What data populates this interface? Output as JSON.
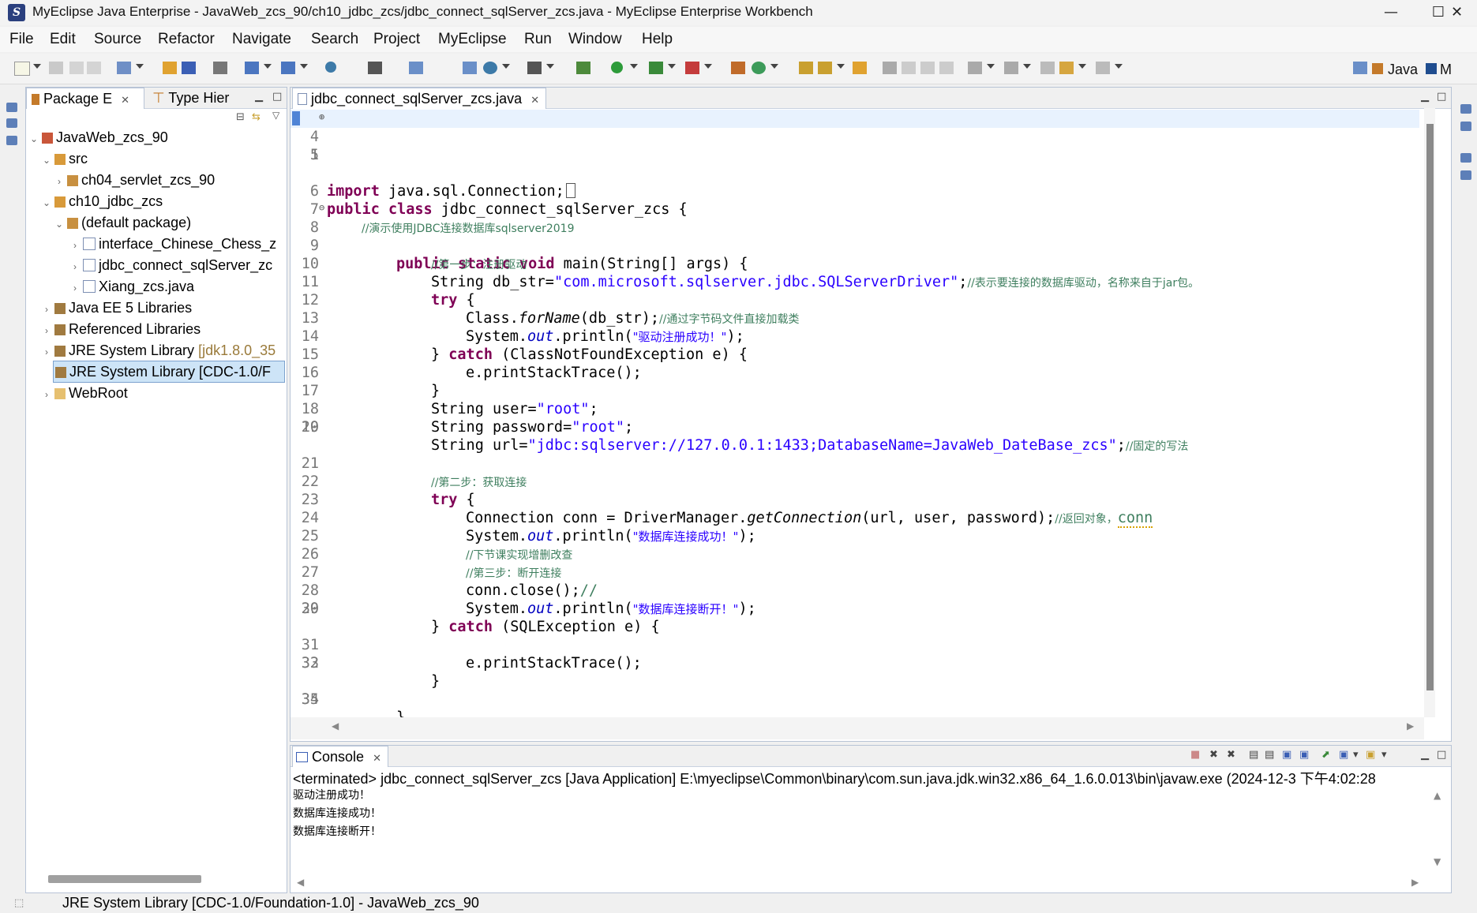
{
  "window": {
    "title": "MyEclipse Java Enterprise - JavaWeb_zcs_90/ch10_jdbc_zcs/jdbc_connect_sqlServer_zcs.java - MyEclipse Enterprise Workbench",
    "minimize": "—",
    "maximize": "☐",
    "close": "✕"
  },
  "menu": [
    "File",
    "Edit",
    "Source",
    "Refactor",
    "Navigate",
    "Search",
    "Project",
    "MyEclipse",
    "Run",
    "Window",
    "Help"
  ],
  "perspectives": {
    "java": "Java",
    "myeclipse": "M"
  },
  "package_explorer": {
    "tab_label": "Package E",
    "tab2_label": "Type Hier",
    "tree": [
      {
        "label": "JavaWeb_zcs_90",
        "icon": "project-icon"
      },
      {
        "label": "src",
        "icon": "source-folder-icon"
      },
      {
        "label": "ch04_servlet_zcs_90",
        "icon": "package-icon"
      },
      {
        "label": "ch10_jdbc_zcs",
        "icon": "source-folder-icon"
      },
      {
        "label": "(default package)",
        "icon": "package-icon"
      },
      {
        "label": "interface_Chinese_Chess_z",
        "icon": "java-file-icon"
      },
      {
        "label": "jdbc_connect_sqlServer_zc",
        "icon": "java-file-icon"
      },
      {
        "label": "Xiang_zcs.java",
        "icon": "java-file-icon"
      },
      {
        "label": "Java EE 5 Libraries",
        "icon": "library-icon"
      },
      {
        "label": "Referenced Libraries",
        "icon": "library-icon"
      },
      {
        "label": "JRE System Library",
        "suffix": "[jdk1.8.0_35",
        "icon": "library-icon"
      },
      {
        "label": "JRE System Library [CDC-1.0/F",
        "icon": "library-icon"
      },
      {
        "label": "WebRoot",
        "icon": "folder-icon"
      }
    ]
  },
  "editor": {
    "tab_label": "jdbc_connect_sqlServer_zcs.java",
    "line_numbers": [
      "1",
      "4",
      "5",
      "6",
      "7",
      "8",
      "9",
      "10",
      "11",
      "12",
      "13",
      "14",
      "15",
      "16",
      "17",
      "18",
      "19",
      "20",
      "21",
      "22",
      "23",
      "24",
      "25",
      "26",
      "27",
      "28",
      "29",
      "30",
      "31",
      "32",
      "33",
      "34",
      "35"
    ],
    "code": {
      "l1_kw": "import",
      "l1_rest": " java.sql.Connection;",
      "l6_kw1": "public",
      "l6_kw2": "class",
      "l6_rest": " jdbc_connect_sqlServer_zcs {",
      "l7_cm": "//演示使用JDBC连接数据库sqlserver2019",
      "l8_kw": "public static void",
      "l8_rest": " main(String[] args) {",
      "l9_cm": "//第一步：注册驱动",
      "l10_a": "String db_str=",
      "l10_str": "\"com.microsoft.sqlserver.jdbc.SQLServerDriver\"",
      "l10_b": ";",
      "l10_cm": "//表示要连接的数据库驱动，名称来自于jar包。",
      "l11_kw": "try",
      "l11_rest": " {",
      "l12_a": "Class.",
      "l12_it": "forName",
      "l12_b": "(db_str);",
      "l12_cm": "//通过字节码文件直接加载类",
      "l13_a": "System.",
      "l13_fld": "out",
      "l13_b": ".println(",
      "l13_str": "\"驱动注册成功！\"",
      "l13_c": ");",
      "l14_a": "} ",
      "l14_kw": "catch",
      "l14_b": " (ClassNotFoundException e) {",
      "l15": "e.printStackTrace();",
      "l16": "}",
      "l17_a": "String user=",
      "l17_str": "\"root\"",
      "l17_b": ";",
      "l18_a": "String password=",
      "l18_str": "\"root\"",
      "l18_b": ";",
      "l19_a": "String url=",
      "l19_str": "\"jdbc:sqlserver://127.0.0.1:1433;DatabaseName=JavaWeb_DateBase_zcs\"",
      "l19_b": ";",
      "l19_cm": "//固定的写法",
      "l21_cm": "//第二步：获取连接",
      "l22_kw": "try",
      "l22_rest": " {",
      "l23_a": "Connection conn = DriverManager.",
      "l23_it": "getConnection",
      "l23_b": "(url, user, password);",
      "l23_cm": "//返回对象，",
      "l23_cm2": "conn",
      "l24_a": "System.",
      "l24_fld": "out",
      "l24_b": ".println(",
      "l24_str": "\"数据库连接成功！\"",
      "l24_c": ");",
      "l25_cm": "//下节课实现增删改查",
      "l26_cm": "//第三步：断开连接",
      "l27_a": "conn.close();",
      "l27_cm": "//",
      "l28_a": "System.",
      "l28_fld": "out",
      "l28_b": ".println(",
      "l28_str": "\"数据库连接断开！\"",
      "l28_c": ");",
      "l29_a": "} ",
      "l29_kw": "catch",
      "l29_b": " (SQLException e) {",
      "l31": "e.printStackTrace();",
      "l32": "}",
      "l34": "}"
    }
  },
  "console": {
    "tab_label": "Console",
    "header": "<terminated> jdbc_connect_sqlServer_zcs [Java Application] E:\\myeclipse\\Common\\binary\\com.sun.java.jdk.win32.x86_64_1.6.0.013\\bin\\javaw.exe (2024-12-3 下午4:02:28",
    "output": [
      "驱动注册成功！",
      "数据库连接成功！",
      "数据库连接断开！"
    ]
  },
  "status_bar": {
    "text": "JRE System Library [CDC-1.0/Foundation-1.0] - JavaWeb_zcs_90"
  },
  "colors": {
    "keyword": "#7f0055",
    "comment": "#3f7f5f",
    "string": "#2a00ff",
    "field": "#0000c0",
    "selection": "#cde4f7"
  }
}
